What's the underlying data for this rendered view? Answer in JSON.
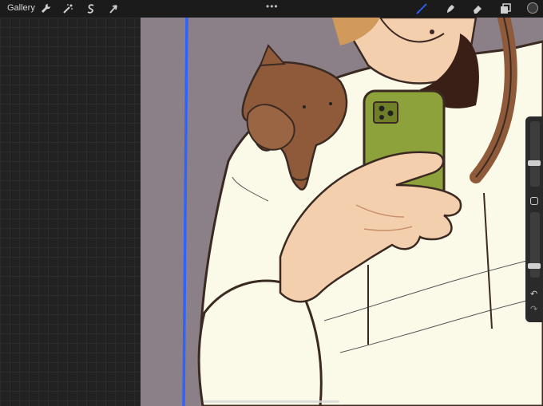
{
  "topbar": {
    "gallery_label": "Gallery",
    "actions_icon": "wrench-icon",
    "adjustments_icon": "magic-wand-icon",
    "selection_icon": "selection-s-icon",
    "transform_icon": "arrow-cursor-icon",
    "more_label": "•••",
    "brush_icon": "brush-icon",
    "smudge_icon": "smudge-icon",
    "eraser_icon": "eraser-icon",
    "layers_icon": "layers-icon",
    "active_color": "#3a3a3a"
  },
  "sidebar": {
    "brush_size_level": 0.35,
    "opacity_level": 0.15,
    "undo_label": "↶",
    "redo_label": "↷"
  },
  "colors": {
    "accent_blue": "#2f63ff",
    "canvas_background": "#8b8088",
    "hoodie": "#fbf9e8",
    "phone": "#8ea23b",
    "cat": "#8e5a3a",
    "skin": "#f4cfae",
    "hair": "#d19a5a"
  }
}
